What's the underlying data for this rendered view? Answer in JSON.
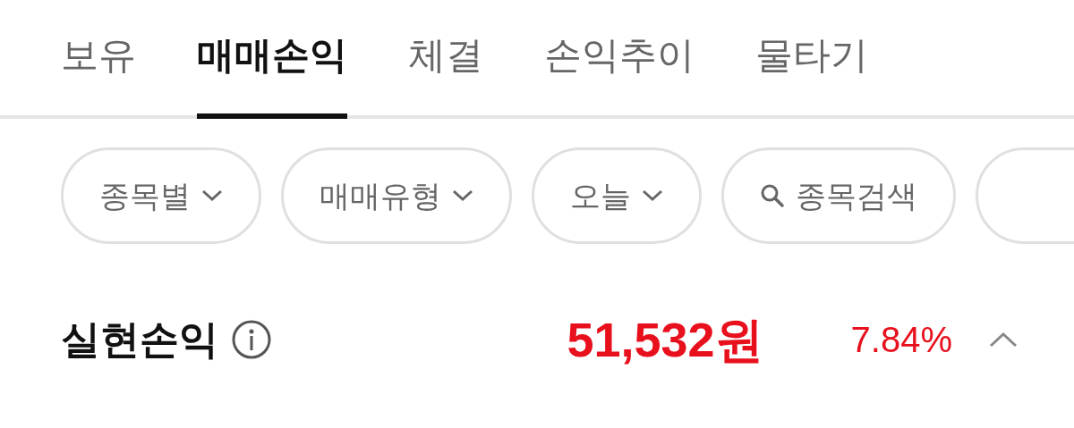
{
  "tabs": [
    {
      "label": "보유",
      "selected": false
    },
    {
      "label": "매매손익",
      "selected": true
    },
    {
      "label": "체결",
      "selected": false
    },
    {
      "label": "손익추이",
      "selected": false
    },
    {
      "label": "물타기",
      "selected": false
    }
  ],
  "filters": [
    {
      "kind": "dropdown",
      "label": "종목별"
    },
    {
      "kind": "dropdown",
      "label": "매매유형"
    },
    {
      "kind": "dropdown",
      "label": "오늘"
    },
    {
      "kind": "search",
      "label": "종목검색"
    }
  ],
  "realized_pnl": {
    "label": "실현손익",
    "amount": "51,532원",
    "rate": "7.84%"
  }
}
